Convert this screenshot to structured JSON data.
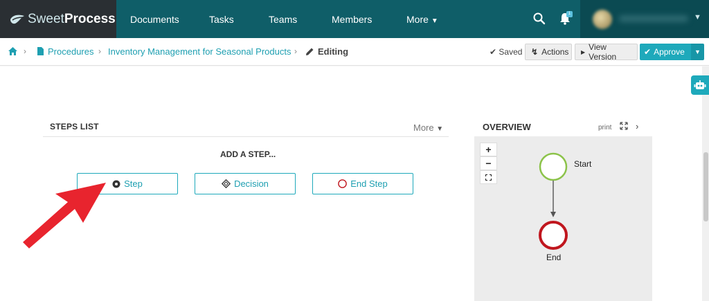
{
  "brand": {
    "sweet": "Sweet",
    "process": "Process"
  },
  "nav": {
    "documents": "Documents",
    "tasks": "Tasks",
    "teams": "Teams",
    "members": "Members",
    "more": "More",
    "notification_count": "1"
  },
  "breadcrumb": {
    "home_icon": "home-icon",
    "procedures": "Procedures",
    "procedure_name": "Inventory Management for Seasonal Products",
    "editing": "Editing"
  },
  "toolbar": {
    "saved": "Saved",
    "actions": "Actions",
    "view_version": "View Version",
    "approve": "Approve"
  },
  "steps_list": {
    "title": "STEPS LIST",
    "more": "More",
    "add_step_heading": "ADD A STEP...",
    "buttons": {
      "step": "Step",
      "decision": "Decision",
      "end_step": "End Step"
    }
  },
  "overview": {
    "title": "OVERVIEW",
    "print": "print",
    "zoom_in": "+",
    "zoom_out": "−",
    "nodes": {
      "start": "Start",
      "end": "End"
    }
  },
  "colors": {
    "nav_bg": "#0f5e68",
    "accent": "#1ea9bb",
    "start_node": "#8cc34a",
    "end_node": "#c0161e",
    "arrow": "#e8242e"
  }
}
